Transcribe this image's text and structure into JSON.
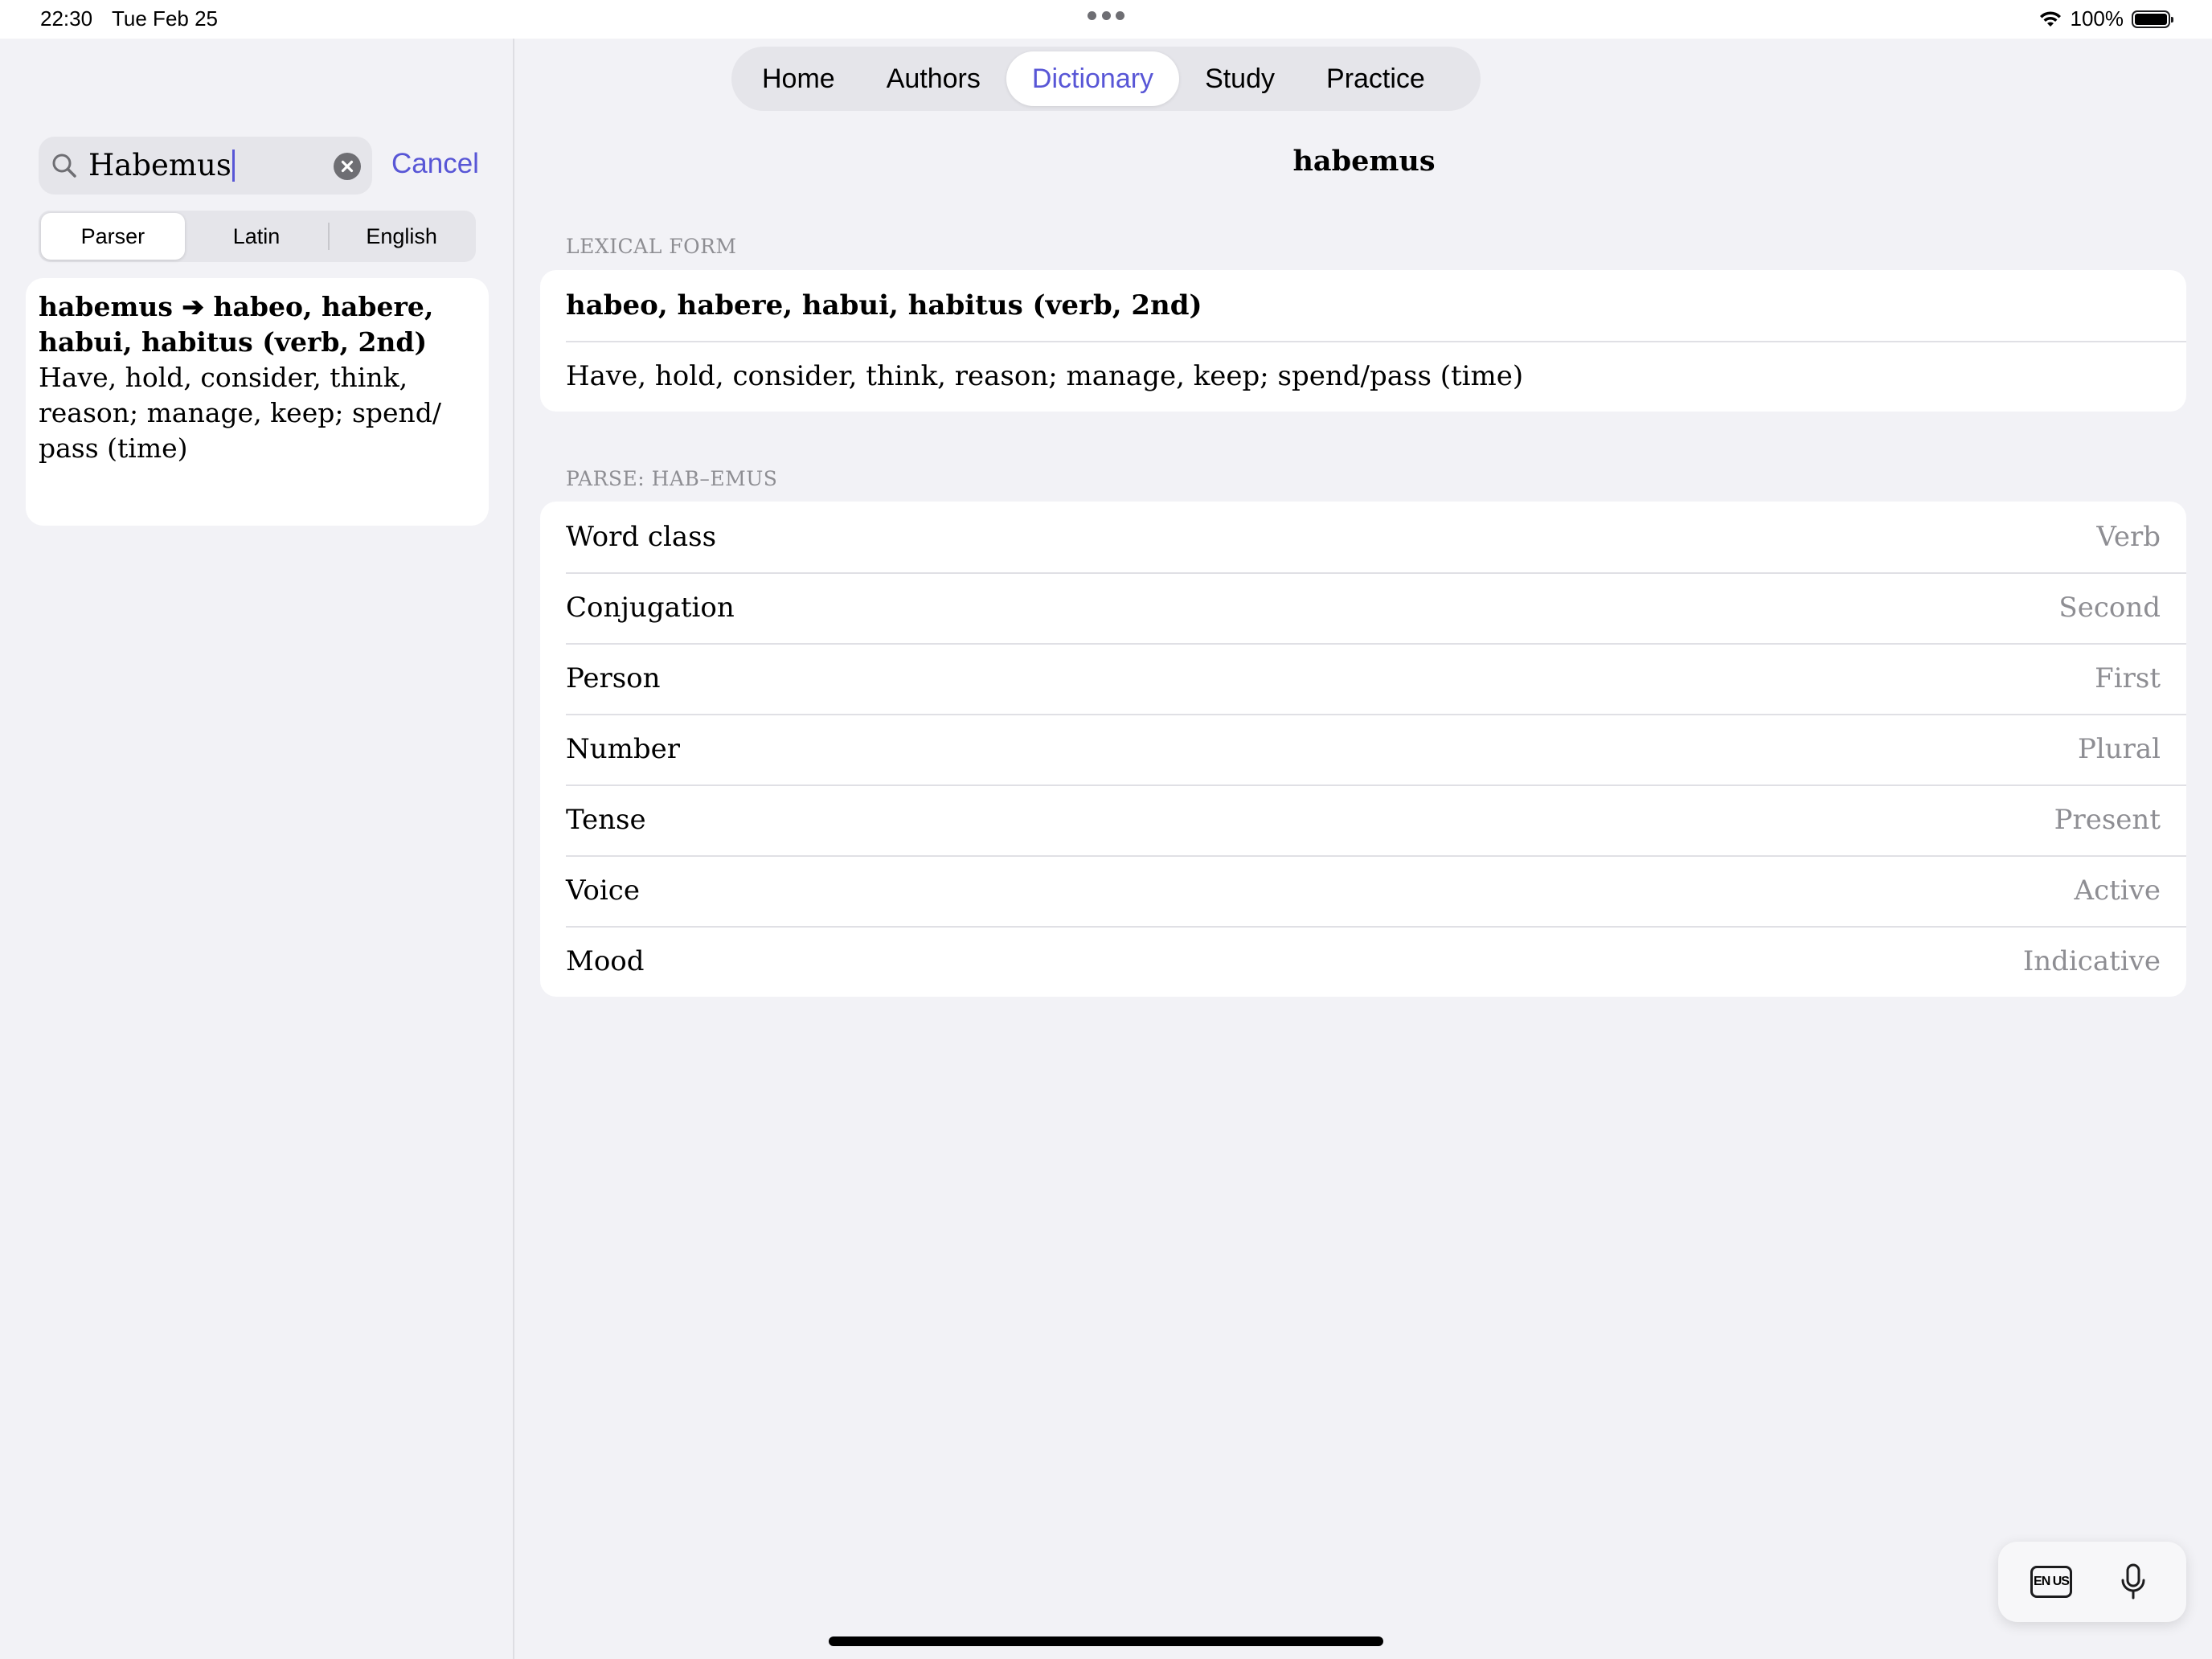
{
  "status_bar": {
    "time": "22:30",
    "date": "Tue Feb 25",
    "battery": "100%"
  },
  "sidebar": {
    "search": {
      "value": "Habemus",
      "cancel_label": "Cancel"
    },
    "segments": [
      {
        "label": "Parser",
        "selected": true
      },
      {
        "label": "Latin",
        "selected": false
      },
      {
        "label": "English",
        "selected": false
      }
    ],
    "result": {
      "title": "habemus ➔ habeo, habere, habui, habitus (verb, 2nd)",
      "definition": "Have, hold, consider, think, reason; manage, keep; spend/ pass (time)"
    }
  },
  "nav": {
    "tabs": [
      {
        "label": "Home",
        "selected": false
      },
      {
        "label": "Authors",
        "selected": false
      },
      {
        "label": "Dictionary",
        "selected": true
      },
      {
        "label": "Study",
        "selected": false
      },
      {
        "label": "Practice",
        "selected": false
      }
    ]
  },
  "main": {
    "title": "habemus",
    "lexical": {
      "header": "LEXICAL FORM",
      "form": "habeo, habere, habui, habitus (verb, 2nd)",
      "meaning": "Have, hold, consider, think, reason; manage, keep; spend/pass (time)"
    },
    "parse": {
      "header": "PARSE: HAB–EMUS",
      "rows": [
        {
          "label": "Word class",
          "value": "Verb"
        },
        {
          "label": "Conjugation",
          "value": "Second"
        },
        {
          "label": "Person",
          "value": "First"
        },
        {
          "label": "Number",
          "value": "Plural"
        },
        {
          "label": "Tense",
          "value": "Present"
        },
        {
          "label": "Voice",
          "value": "Active"
        },
        {
          "label": "Mood",
          "value": "Indicative"
        }
      ]
    }
  },
  "keyboard": {
    "language_label": "EN US",
    "icons": [
      "language-icon",
      "microphone-icon"
    ]
  },
  "colors": {
    "accent": "#5856d6",
    "background": "#f2f2f6",
    "secondary_text": "#8e8e93"
  }
}
